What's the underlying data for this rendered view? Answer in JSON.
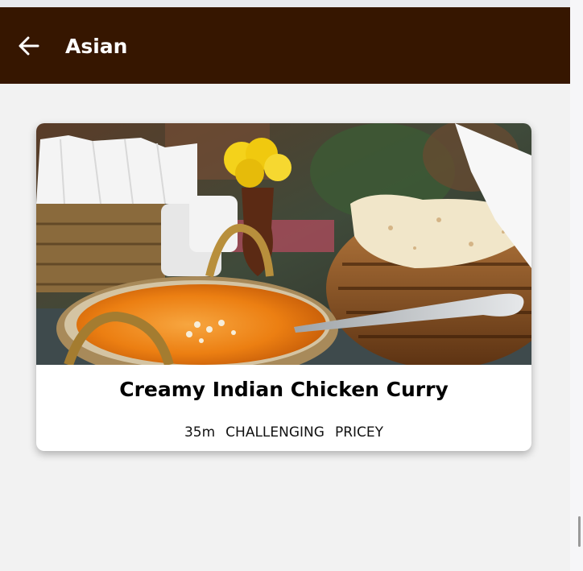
{
  "header": {
    "back_icon": "arrow-left-icon",
    "title": "Asian",
    "background_color": "#361600"
  },
  "meal": {
    "title": "Creamy Indian Chicken Curry",
    "image_description_icon": "curry-photo",
    "duration": "35m",
    "complexity": "CHALLENGING",
    "affordability": "PRICEY"
  }
}
